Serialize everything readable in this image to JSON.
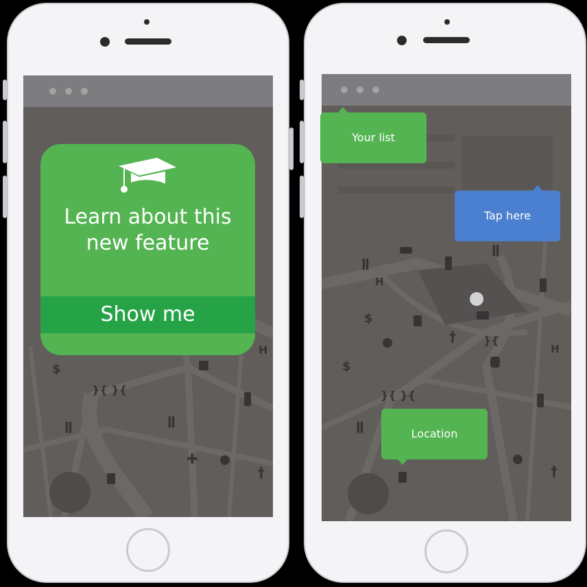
{
  "left_phone": {
    "feature_card": {
      "icon": "graduation-cap-icon",
      "title_line1": "Learn about this",
      "title_line2": "new feature",
      "button_label": "Show me"
    }
  },
  "right_phone": {
    "tooltips": {
      "your_list": "Your list",
      "tap_here": "Tap here",
      "location": "Location"
    }
  },
  "colors": {
    "card_green": "#54b452",
    "button_green": "#27a347",
    "tooltip_blue": "#4a80cf",
    "map_background": "#615d5b"
  },
  "map_icons": [
    "fork-knife-icon",
    "hospital-h-icon",
    "dollar-icon",
    "cross-icon",
    "bus-icon",
    "traffic-light-icon",
    "police-badge-icon",
    "mail-icon",
    "car-icon",
    "first-aid-icon"
  ]
}
